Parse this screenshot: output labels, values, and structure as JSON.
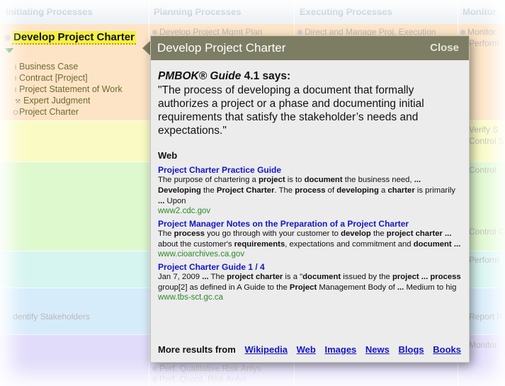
{
  "columns": [
    "Initiating Processes",
    "Planning Processes",
    "Executing Processes",
    "Monitor"
  ],
  "task": {
    "title": "Develop Project Charter",
    "inputs": [
      "Business Case",
      "Contract [Project]",
      "Project Statement of Work"
    ],
    "tools": [
      "Expert Judgment"
    ],
    "outputs": [
      "Project Charter"
    ]
  },
  "background_items": {
    "planning_top": "Develop Project Mgmt Plan",
    "executing_top": "Direct and Manage Proj. Execution",
    "monitor_top": "Monitor",
    "monitor_top2": "Perform",
    "monitor_verify": "Verify S",
    "monitor_control_s": "Control S",
    "monitor_control1": "Control",
    "monitor_control2": "Control C",
    "monitor_perform": "Perform",
    "initiating_stakeholders": "dentify Stakeholders",
    "monitor_report": "Report P",
    "monitor_monitor": "Monitor",
    "planning_qual": "Perf. Qualitative Risk Anlys",
    "planning_quant": "Perf. Quant. Risk Anlys"
  },
  "popup": {
    "title": "Develop Project Charter",
    "close_label": "Close",
    "guide_name": "PMBOK® Guide",
    "guide_ref": "4.1 says:",
    "quote": "\"The process of developing a document that formally authorizes a project or a phase and documenting initial requirements that satisfy the stakeholder’s needs and expectations.\"",
    "web_heading": "Web",
    "results": [
      {
        "title": "Project Charter Practice Guide",
        "snippet": "The purpose of chartering a project is to document the business need, ... Developing the Project Charter. The process of developing a charter is primarily ... Upon",
        "url": "www2.cdc.gov"
      },
      {
        "title": "Project Manager Notes on the Preparation of a Project Charter",
        "snippet": "The process you go through with your customer to develop the project charter ... about the customer's requirements, expectations and commitment and document ...",
        "url": "www.cioarchives.ca.gov"
      },
      {
        "title": "Project Charter Guide 1 / 4",
        "snippet": "Jan 7, 2009 ... The project charter is a \"document issued by the project ... process group[2] as defined in A Guide to the Project Management Body of ... Medium to hig",
        "url": "www.tbs-sct.gc.ca"
      }
    ],
    "more_label": "More results from",
    "more_links": [
      "Wikipedia",
      "Web",
      "Images",
      "News",
      "Blogs",
      "Books"
    ]
  },
  "colors": {
    "band_initiating": "#fde4c6",
    "band_yellow": "#fafbc4",
    "band_green": "#dff9cf",
    "band_cyan": "#d6f5f0",
    "band_blue": "#d7ecfb",
    "band_violet": "#e2dcfb",
    "popup_header": "#7d7d63",
    "highlight": "#f5f042",
    "link": "#1515c9",
    "url": "#2a8a28"
  }
}
